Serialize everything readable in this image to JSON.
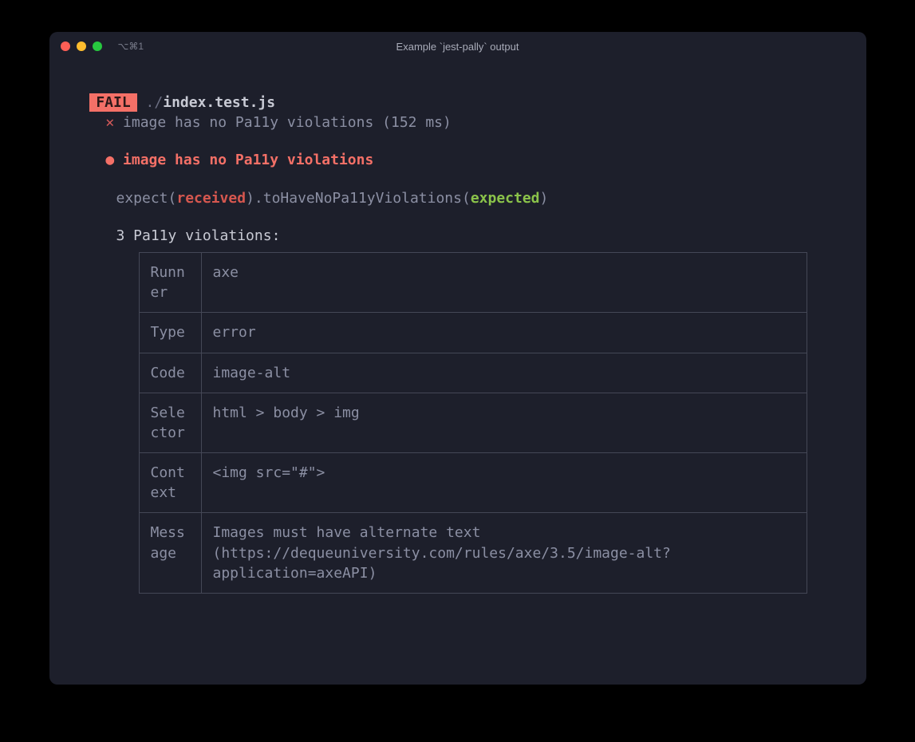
{
  "titlebar": {
    "tab_label": "⌥⌘1",
    "window_title": "Example `jest-pally` output"
  },
  "output": {
    "fail_badge": "FAIL",
    "path_prefix": "./",
    "path_file": "index.test.js",
    "cross_mark": "✕",
    "test_summary": "image has no Pa11y violations (152 ms)",
    "bullet": "●",
    "test_name": "image has no Pa11y violations",
    "expect_prefix": "expect(",
    "received": "received",
    "expect_mid": ").toHaveNoPa11yViolations(",
    "expected": "expected",
    "expect_suffix": ")",
    "violations_header": "3 Pa11y violations:"
  },
  "violation_rows": [
    {
      "label": "Runner",
      "value": "axe"
    },
    {
      "label": "Type",
      "value": "error"
    },
    {
      "label": "Code",
      "value": "image-alt"
    },
    {
      "label": "Selector",
      "value": "html > body > img"
    },
    {
      "label": "Context",
      "value": "<img src=\"#\">"
    },
    {
      "label": "Message",
      "value": "Images must have alternate text (https://dequeuniversity.com/rules/axe/3.5/image-alt?application=axeAPI)"
    }
  ]
}
